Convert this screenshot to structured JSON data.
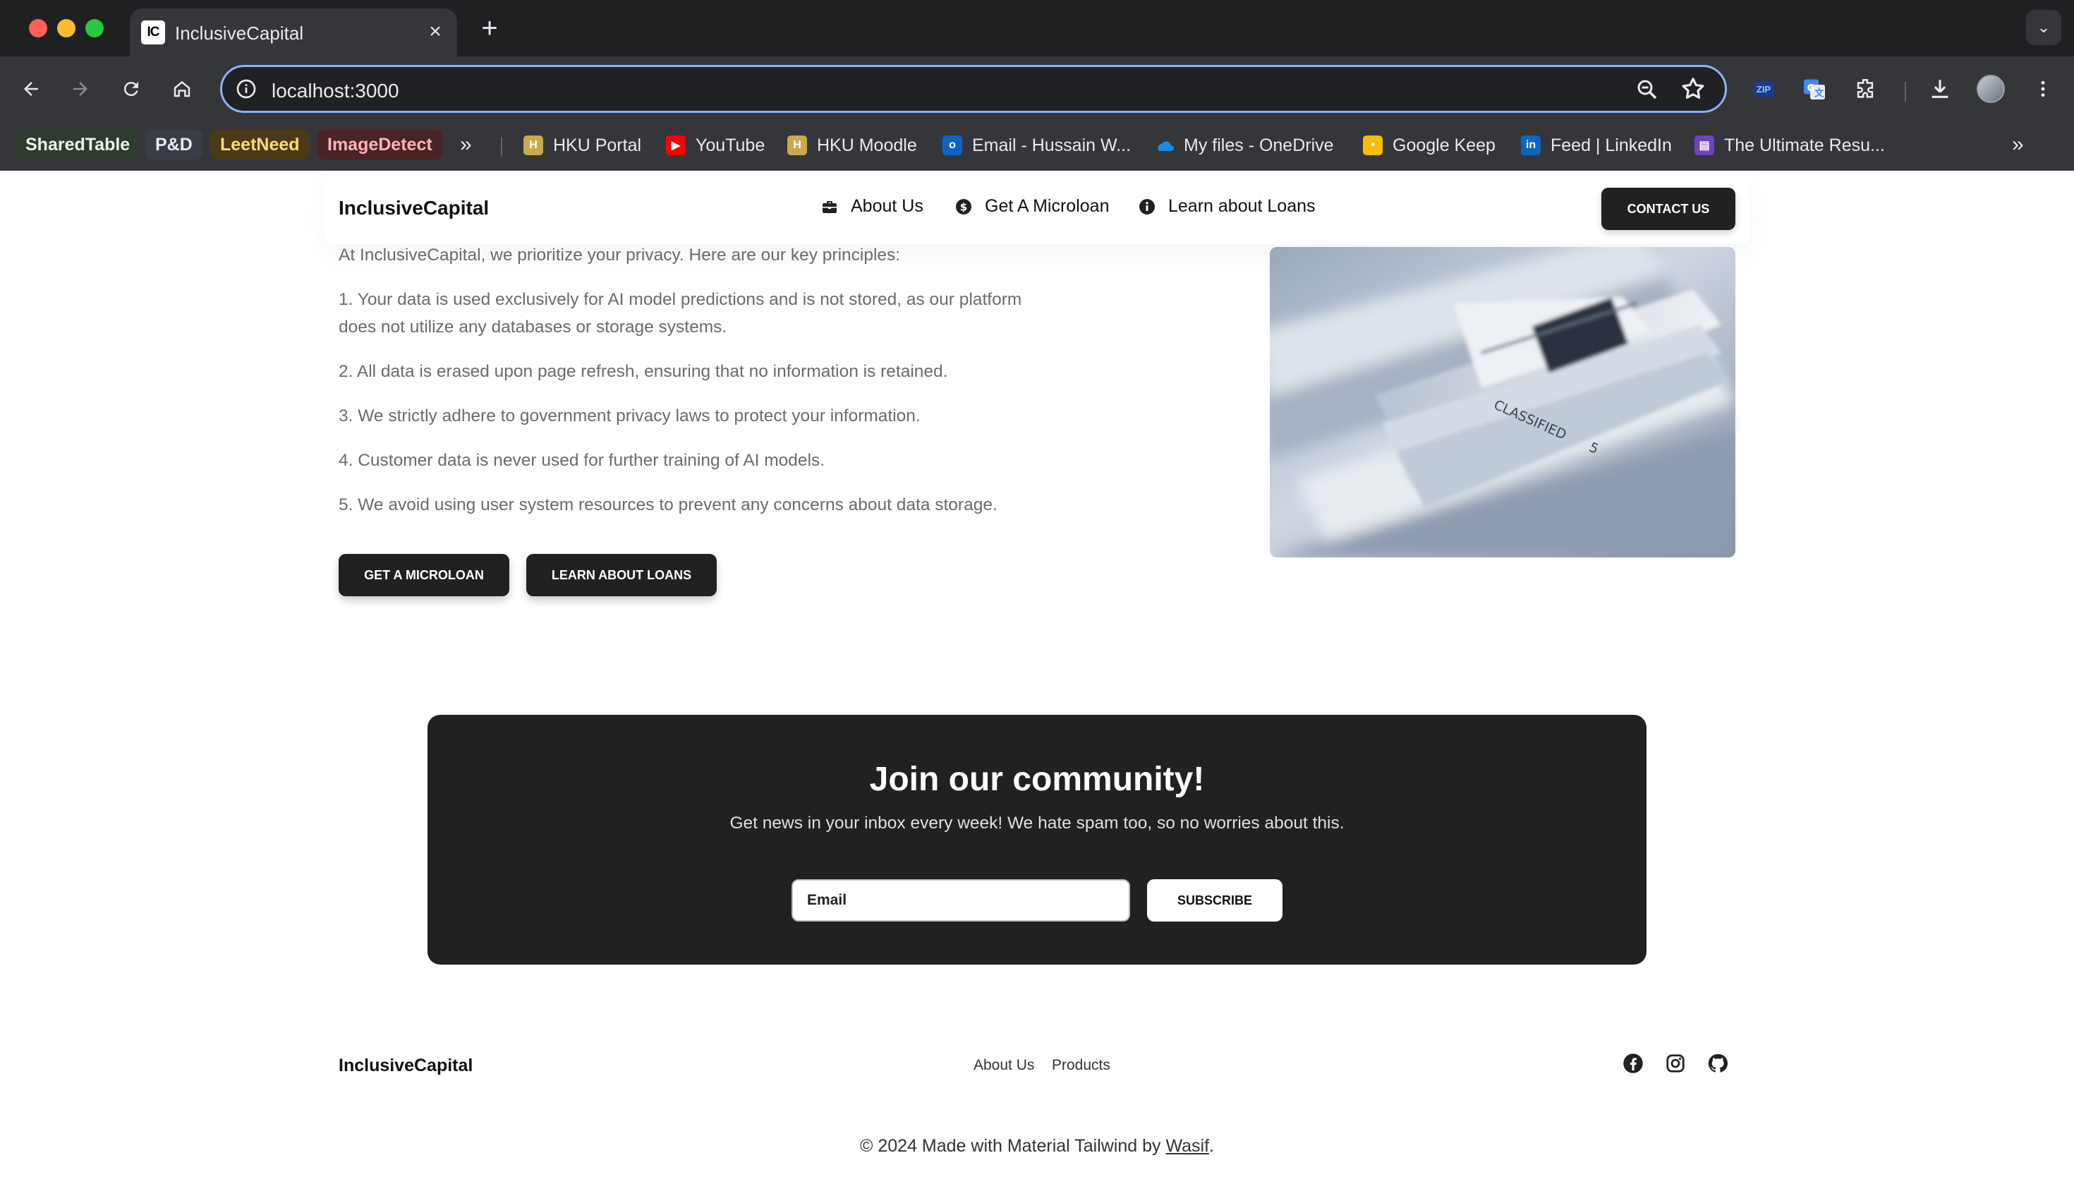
{
  "browser": {
    "tab_title": "InclusiveCapital",
    "tab_favicon_text": "IC",
    "url": "localhost:3000",
    "bookmark_chips": [
      {
        "label": "SharedTable",
        "bg": "#2f3b2f",
        "color": "#e8f5e9"
      },
      {
        "label": "P&D",
        "bg": "#3a3d45",
        "color": "#e8eaed"
      },
      {
        "label": "LeetNeed",
        "bg": "#4a3b16",
        "color": "#ffd97a"
      },
      {
        "label": "ImageDetect",
        "bg": "#4a2327",
        "color": "#ffb3b8"
      }
    ],
    "bookmarks": [
      {
        "label": "HKU Portal",
        "icon": "hku-icon"
      },
      {
        "label": "YouTube",
        "icon": "youtube-icon"
      },
      {
        "label": "HKU Moodle",
        "icon": "moodle-icon"
      },
      {
        "label": "Email - Hussain W...",
        "icon": "outlook-icon"
      },
      {
        "label": "My files - OneDrive",
        "icon": "onedrive-icon"
      },
      {
        "label": "Google Keep",
        "icon": "keep-icon"
      },
      {
        "label": "Feed | LinkedIn",
        "icon": "linkedin-icon"
      },
      {
        "label": "The Ultimate Resu...",
        "icon": "resume-icon"
      }
    ],
    "zip_label": "ZIP"
  },
  "navbar": {
    "brand": "InclusiveCapital",
    "links": [
      {
        "label": "About Us",
        "icon": "briefcase-icon"
      },
      {
        "label": "Get A Microloan",
        "icon": "dollar-icon"
      },
      {
        "label": "Learn about Loans",
        "icon": "info-icon"
      }
    ],
    "contact_label": "CONTACT US"
  },
  "privacy": {
    "intro": "At InclusiveCapital, we prioritize your privacy. Here are our key principles:",
    "items": [
      "1. Your data is used exclusively for AI model predictions and is not stored, as our platform does not utilize any databases or storage systems.",
      "2. All data is erased upon page refresh, ensuring that no information is retained.",
      "3. We strictly adhere to government privacy laws to protect your information.",
      "4. Customer data is never used for further training of AI models.",
      "5. We avoid using user system resources to prevent any concerns about data storage."
    ],
    "cta_microloan": "GET A MICROLOAN",
    "cta_learn": "LEARN ABOUT LOANS",
    "photo_label": "CLASSIFIED",
    "photo_number": "5"
  },
  "newsletter": {
    "title": "Join our community!",
    "subtitle": "Get news in your inbox every week! We hate spam too, so no worries about this.",
    "email_placeholder": "Email",
    "subscribe_label": "SUBSCRIBE"
  },
  "footer": {
    "brand": "InclusiveCapital",
    "links": [
      "About Us",
      "Products"
    ],
    "social": [
      "facebook-icon",
      "instagram-icon",
      "github-icon"
    ],
    "copyright_prefix": "© 2024 Made with Material Tailwind by ",
    "copyright_author": "Wasif",
    "copyright_suffix": "."
  }
}
